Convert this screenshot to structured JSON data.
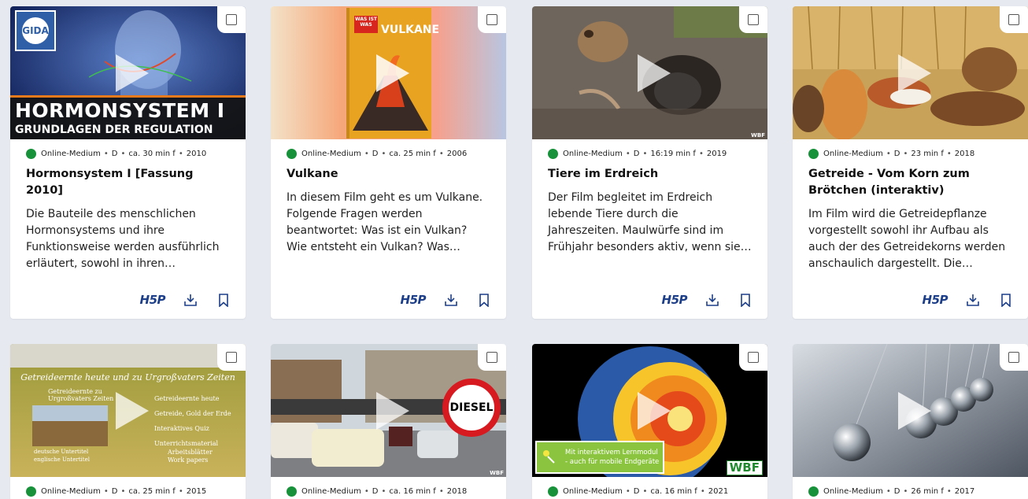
{
  "cards": [
    {
      "meta": {
        "medium": "Online-Medium",
        "lang": "D",
        "duration": "ca. 30 min f",
        "year": "2010"
      },
      "title": "Hormonsystem I [Fassung 2010]",
      "description": "Die Bauteile des menschlichen Hormonsystems und ihre Funktionsweise werden ausführlich erläutert, sowohl in ihren speziellen…",
      "thumb": {
        "line1": "HORMONSYSTEM I",
        "line2": "GRUNDLAGEN DER REGULATION",
        "logo": "GIDA"
      }
    },
    {
      "meta": {
        "medium": "Online-Medium",
        "lang": "D",
        "duration": "ca. 25 min f",
        "year": "2006"
      },
      "title": "Vulkane",
      "description": "In diesem Film geht es um Vulkane. Folgende Fragen werden beantwortet: Was ist ein Vulkan? Wie entsteht ein Vulkan? Was geschieht bei einem…",
      "thumb": {
        "brand": "WAS IST WAS",
        "cover_title": "VULKANE"
      }
    },
    {
      "meta": {
        "medium": "Online-Medium",
        "lang": "D",
        "duration": "16:19 min f",
        "year": "2019"
      },
      "title": "Tiere im Erdreich",
      "description": "Der Film begleitet im Erdreich lebende Tiere durch die Jahreszeiten. Maulwürfe sind im Frühjahr besonders aktiv, wenn sie ihr unterirdisches…",
      "thumb": {
        "tag": "WBF"
      }
    },
    {
      "meta": {
        "medium": "Online-Medium",
        "lang": "D",
        "duration": "23 min f",
        "year": "2018"
      },
      "title": "Getreide - Vom Korn zum Brötchen (interaktiv)",
      "description": "Im Film wird die Getreidepflanze vorgestellt sowohl ihr Aufbau als auch der des Getreidekorns werden anschaulich dargestellt. Die…",
      "thumb": {}
    },
    {
      "meta": {
        "medium": "Online-Medium",
        "lang": "D",
        "duration": "ca. 25 min f",
        "year": "2015"
      },
      "title": "",
      "description": "",
      "thumb": {
        "header": "Getreideernte heute und zu Urgroßvaters Zeiten",
        "menu": [
          "Getreideernte zu Urgroßvaters Zeiten",
          "Getreideernte heute",
          "Getreide, Gold der Erde",
          "Interaktives Quiz",
          "Unterrichtsmaterial",
          "Arbeitsblätter",
          "Work papers",
          "deutsche Untertitel",
          "englische Untertitel"
        ]
      }
    },
    {
      "meta": {
        "medium": "Online-Medium",
        "lang": "D",
        "duration": "ca. 16 min f",
        "year": "2018"
      },
      "title": "",
      "description": "",
      "thumb": {
        "sign": "DIESEL",
        "tag": "WBF"
      }
    },
    {
      "meta": {
        "medium": "Online-Medium",
        "lang": "D",
        "duration": "ca. 16 min f",
        "year": "2021"
      },
      "title": "",
      "description": "",
      "thumb": {
        "badge_line1": "Mit interaktivem Lernmodul",
        "badge_line2": "- auch für mobile Endgeräte",
        "logo": "WBF"
      }
    },
    {
      "meta": {
        "medium": "Online-Medium",
        "lang": "D",
        "duration": "26 min f",
        "year": "2017"
      },
      "title": "",
      "description": "",
      "thumb": {}
    }
  ],
  "actions": {
    "hsp_label": "H5P"
  },
  "colors": {
    "online_dot": "#17923a",
    "accent": "#1d3f8a"
  }
}
